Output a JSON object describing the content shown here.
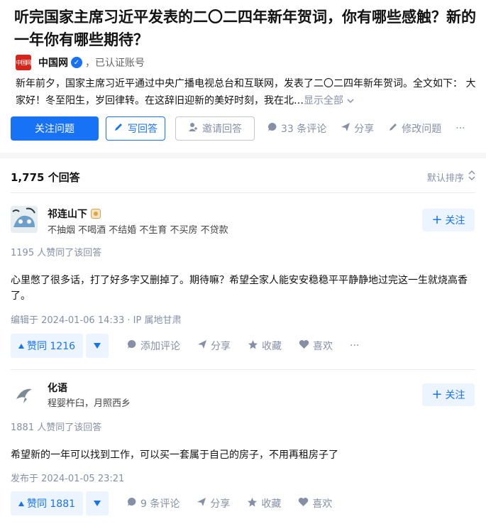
{
  "question": {
    "title": "听完国家主席习近平发表的二〇二四年新年贺词，你有哪些感触？新的一年你有哪些期待？",
    "author": {
      "name": "中国网",
      "logo_text": "中国网",
      "cert": "，已认证账号"
    },
    "summary": "新年前夕，国家主席习近平通过中央广播电视总台和互联网，发表了二〇二四年新年贺词。全文如下：  大家好！冬至阳生，岁回律转。在这辞旧迎新的美好时刻，我在北…",
    "show_all": "显示全部",
    "actions": {
      "follow": "关注问题",
      "write": "写回答",
      "invite": "邀请回答",
      "comments": "33 条评论",
      "share": "分享",
      "edit": "修改问题",
      "more": "···"
    }
  },
  "answer_list": {
    "count": "1,775 个回答",
    "sort": "默认排序"
  },
  "answers": [
    {
      "name": "祁连山下",
      "headline": "不抽烟 不喝酒 不结婚 不生育 不买房 不贷款",
      "follow": "关注",
      "votes_line": "1195 人赞同了该回答",
      "content": "心里憋了很多话，打了好多字又删掉了。期待嘛？希望全家人能安安稳稳平平静静地过完这一生就烧高香了。",
      "time": "编辑于 2024-01-06 14:33 · IP 属地甘肃",
      "vote": "赞同 1216",
      "comment": "添加评论",
      "share": "分享",
      "collect": "收藏",
      "like": "喜欢",
      "more": "···"
    },
    {
      "name": "化语",
      "headline": "程婴杵臼，月照西乡",
      "follow": "关注",
      "votes_line": "1881 人赞同了该回答",
      "content": "希望新的一年可以找到工作，可以买一套属于自己的房子，不用再租房子了",
      "time": "发布于 2024-01-05 23:21",
      "vote": "赞同 1881",
      "comment": "9 条评论",
      "share": "分享",
      "collect": "收藏",
      "like": "喜欢",
      "more": ""
    }
  ],
  "colors": {
    "brand": "#1772f6",
    "muted": "#8590a6",
    "brand_light": "#ebf4ff"
  }
}
